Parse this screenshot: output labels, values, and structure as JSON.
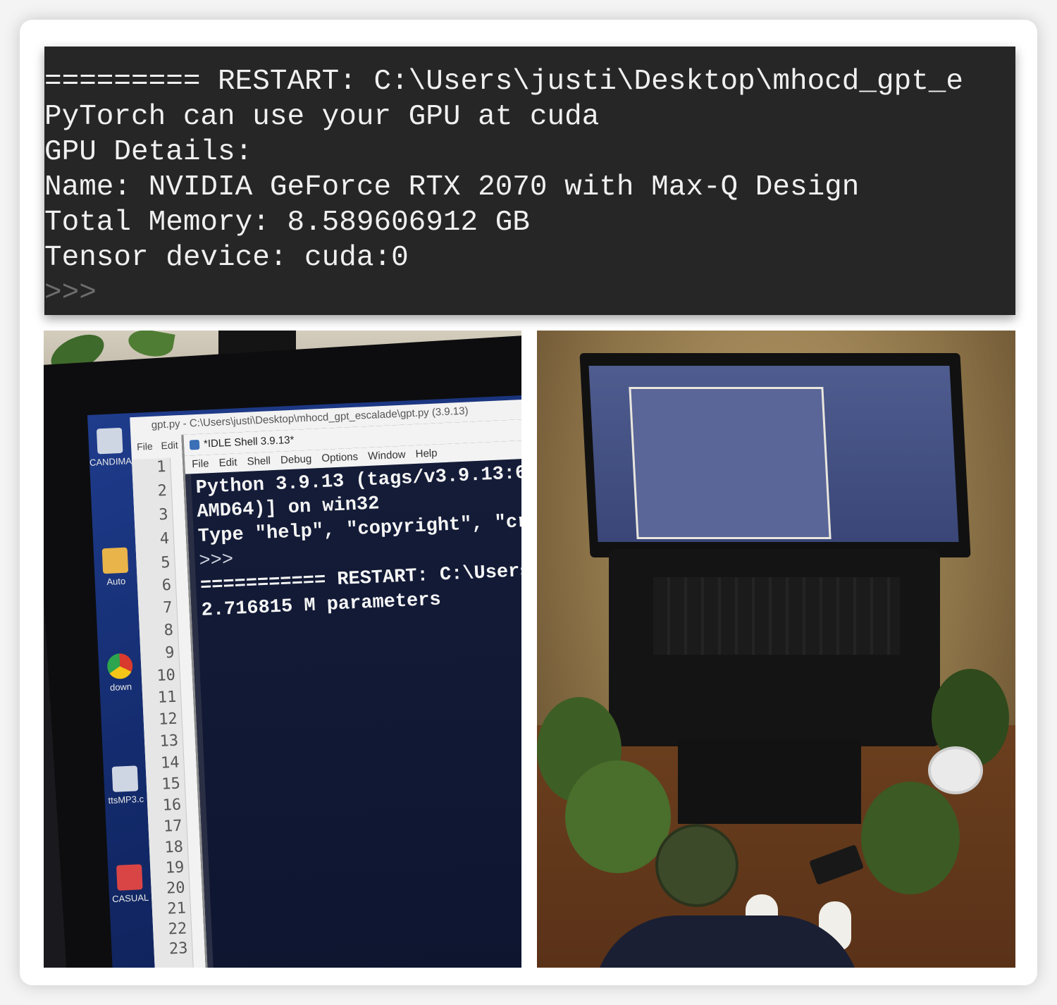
{
  "terminal": {
    "lines": [
      "========= RESTART: C:\\Users\\justi\\Desktop\\mhocd_gpt_e",
      "PyTorch can use your GPU at cuda",
      "GPU Details:",
      "Name: NVIDIA GeForce RTX 2070 with Max-Q Design",
      "Total Memory: 8.589606912 GB",
      "Tensor device: cuda:0"
    ],
    "prompt": ">>>"
  },
  "monitor_photo": {
    "editor": {
      "title": "gpt.py - C:\\Users\\justi\\Desktop\\mhocd_gpt_escalade\\gpt.py (3.9.13)",
      "menu": [
        "File",
        "Edit"
      ],
      "line_numbers": [
        "1",
        "2",
        "3",
        "4",
        "5",
        "6",
        "7",
        "8",
        "9",
        "10",
        "11",
        "12",
        "13",
        "14",
        "15",
        "16",
        "17",
        "18",
        "19",
        "20",
        "21",
        "22",
        "23"
      ]
    },
    "shell": {
      "title": "*IDLE Shell 3.9.13*",
      "menu": [
        "File",
        "Edit",
        "Shell",
        "Debug",
        "Options",
        "Window",
        "Help"
      ],
      "lines": [
        "Python 3.9.13 (tags/v3.9.13:6",
        "AMD64)] on win32",
        "Type \"help\", \"copyright\", \"cr",
        ">>>",
        "=========== RESTART: C:\\Users",
        "2.716815 M parameters"
      ]
    },
    "desktop_icons": [
      {
        "label": "CANDIMAD",
        "icon": "document-icon"
      },
      {
        "label": "Auto",
        "icon": "folder-icon"
      },
      {
        "label": "down",
        "icon": "chrome-icon"
      },
      {
        "label": "ttsMP3.c",
        "icon": "document-icon"
      },
      {
        "label": "CASUAL",
        "icon": "pdf-icon"
      }
    ]
  },
  "colors": {
    "terminal_bg": "#262626",
    "terminal_text": "#f0f0f0",
    "shell_bg": "#111a33"
  }
}
